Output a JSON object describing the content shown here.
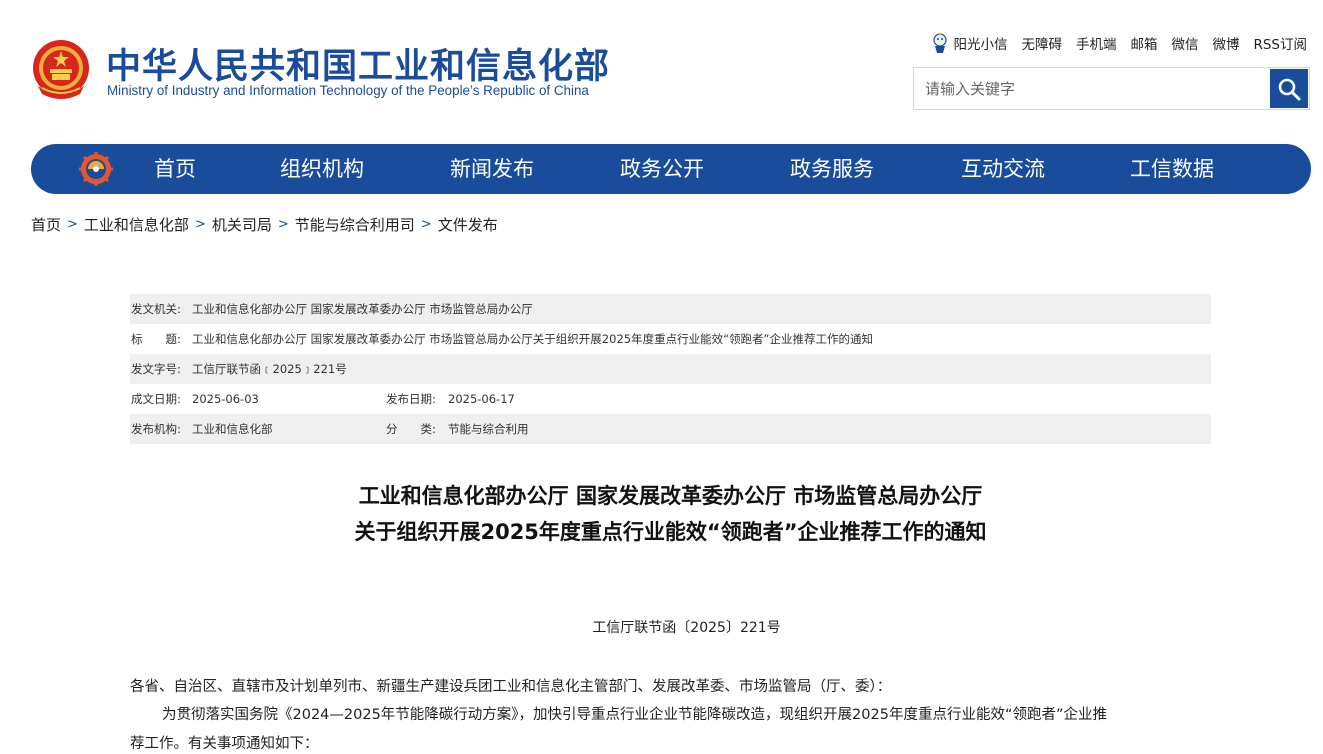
{
  "header": {
    "title_cn": "中华人民共和国工业和信息化部",
    "title_en": "Ministry of Industry and Information Technology of the People’s Republic of China",
    "top_links": [
      "阳光小信",
      "无障碍",
      "手机端",
      "邮箱",
      "微信",
      "微博",
      "RSS订阅"
    ],
    "search_placeholder": "请输入关键字"
  },
  "nav": {
    "items": [
      "首页",
      "组织机构",
      "新闻发布",
      "政务公开",
      "政务服务",
      "互动交流",
      "工信数据"
    ]
  },
  "breadcrumb": [
    "首页",
    "工业和信息化部",
    "机关司局",
    "节能与综合利用司",
    "文件发布"
  ],
  "meta": {
    "issuer_label": "发文机关:",
    "issuer": "工业和信息化部办公厅 国家发展改革委办公厅 市场监管总局办公厅",
    "title_label": "标　　题:",
    "title": "工业和信息化部办公厅 国家发展改革委办公厅 市场监管总局办公厅关于组织开展2025年度重点行业能效“领跑者”企业推荐工作的通知",
    "docno_label": "发文字号:",
    "docno": "工信厅联节函﹝2025﹞221号",
    "created_label": "成文日期:",
    "created": "2025-06-03",
    "published_label": "发布日期:",
    "published": "2025-06-17",
    "org_label": "发布机构:",
    "org": "工业和信息化部",
    "category_label": "分　　类:",
    "category": "节能与综合利用"
  },
  "article": {
    "title_line1": "工业和信息化部办公厅 国家发展改革委办公厅 市场监管总局办公厅",
    "title_line2": "关于组织开展2025年度重点行业能效“领跑者”企业推荐工作的通知",
    "doc_number": "工信厅联节函〔2025〕221号",
    "addressee": "各省、自治区、直辖市及计划单列市、新疆生产建设兵团工业和信息化主管部门、发展改革委、市场监管局（厅、委）：",
    "para1_line1": "为贯彻落实国务院《2024—2025年节能降碳行动方案》，加快引导重点行业企业节能降碳改造，现组织开展2025年度重点行业能效“领跑者”企业推",
    "para1_line2": "荐工作。有关事项通知如下："
  },
  "colors": {
    "brand": "#1a4c9c",
    "meta_shade": "#efefef"
  }
}
